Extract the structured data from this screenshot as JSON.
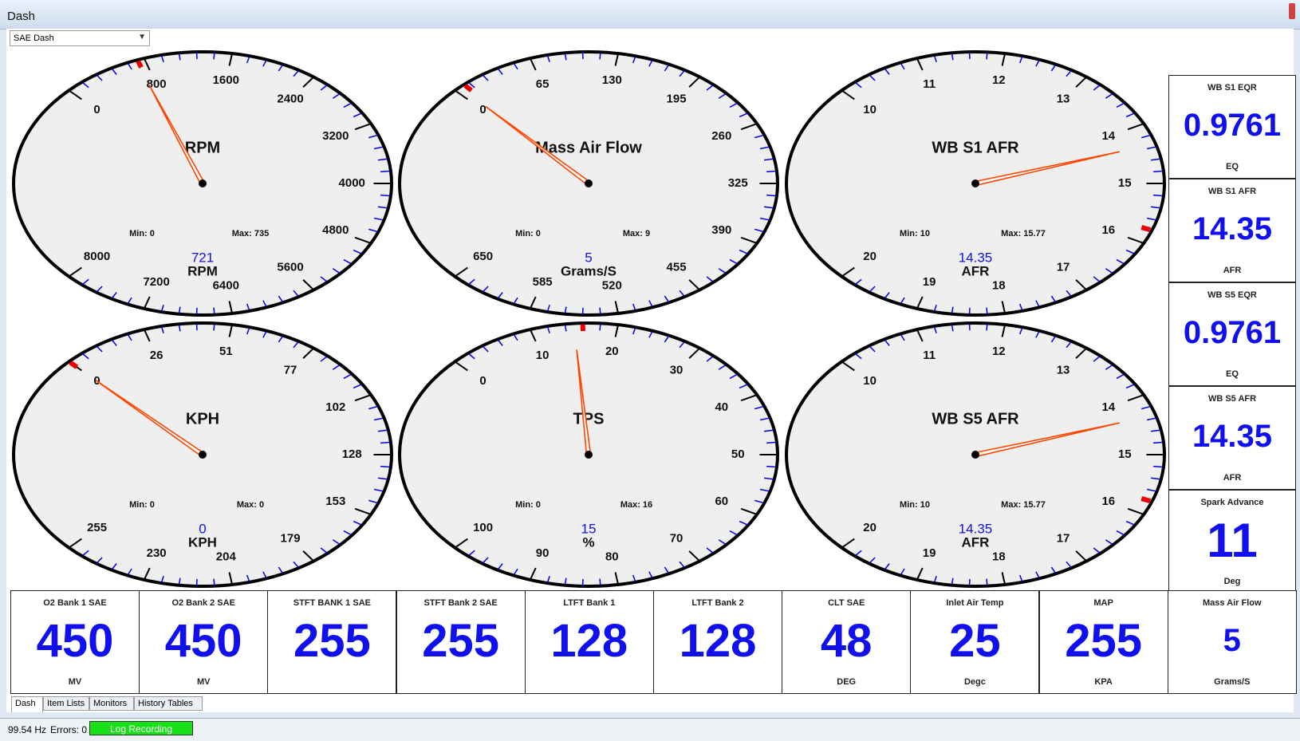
{
  "window": {
    "title": "Dash"
  },
  "selector": {
    "value": "SAE Dash"
  },
  "gauges": [
    {
      "title": "RPM",
      "unit": "RPM",
      "value": 721,
      "value_label": "721",
      "min_label": "Min: 0",
      "max_label": "Max: 735",
      "scale_min": 0,
      "scale_max": 8000,
      "ticks": [
        "0",
        "800",
        "1600",
        "2400",
        "3200",
        "4000",
        "4800",
        "5600",
        "6400",
        "7200",
        "8000"
      ]
    },
    {
      "title": "Mass Air Flow",
      "unit": "Grams/S",
      "value": 5,
      "value_label": "5",
      "min_label": "Min: 0",
      "max_label": "Max: 9",
      "scale_min": 0,
      "scale_max": 650,
      "ticks": [
        "0",
        "65",
        "130",
        "195",
        "260",
        "325",
        "390",
        "455",
        "520",
        "585",
        "650"
      ]
    },
    {
      "title": "WB S1 AFR",
      "unit": "AFR",
      "value": 14.35,
      "value_label": "14.35",
      "min_label": "Min: 10",
      "max_label": "Max: 15.77",
      "scale_min": 10,
      "scale_max": 20,
      "ticks": [
        "10",
        "11",
        "12",
        "13",
        "14",
        "15",
        "16",
        "17",
        "18",
        "19",
        "20"
      ]
    },
    {
      "title": "KPH",
      "unit": "KPH",
      "value": 0,
      "value_label": "0",
      "min_label": "Min: 0",
      "max_label": "Max: 0",
      "scale_min": 0,
      "scale_max": 255,
      "ticks": [
        "0",
        "26",
        "51",
        "77",
        "102",
        "128",
        "153",
        "179",
        "204",
        "230",
        "255"
      ]
    },
    {
      "title": "TPS",
      "unit": "%",
      "value": 15,
      "value_label": "15",
      "min_label": "Min: 0",
      "max_label": "Max: 16",
      "scale_min": 0,
      "scale_max": 100,
      "ticks": [
        "0",
        "10",
        "20",
        "30",
        "40",
        "50",
        "60",
        "70",
        "80",
        "90",
        "100"
      ]
    },
    {
      "title": "WB S5 AFR",
      "unit": "AFR",
      "value": 14.35,
      "value_label": "14.35",
      "min_label": "Min: 10",
      "max_label": "Max: 15.77",
      "scale_min": 10,
      "scale_max": 20,
      "ticks": [
        "10",
        "11",
        "12",
        "13",
        "14",
        "15",
        "16",
        "17",
        "18",
        "19",
        "20"
      ]
    }
  ],
  "side_panels": [
    {
      "label": "WB S1 EQR",
      "value": "0.9761",
      "unit": "EQ"
    },
    {
      "label": "WB S1 AFR",
      "value": "14.35",
      "unit": "AFR"
    },
    {
      "label": "WB S5 EQR",
      "value": "0.9761",
      "unit": "EQ"
    },
    {
      "label": "WB S5 AFR",
      "value": "14.35",
      "unit": "AFR"
    },
    {
      "label": "Spark Advance",
      "value": "11",
      "unit": "Deg"
    }
  ],
  "bottom_panels": [
    {
      "label": "O2 Bank 1 SAE",
      "value": "450",
      "unit": "MV"
    },
    {
      "label": "O2 Bank 2 SAE",
      "value": "450",
      "unit": "MV"
    },
    {
      "label": "STFT BANK 1 SAE",
      "value": "255",
      "unit": ""
    },
    {
      "label": "STFT Bank 2 SAE",
      "value": "255",
      "unit": ""
    },
    {
      "label": "LTFT Bank 1",
      "value": "128",
      "unit": ""
    },
    {
      "label": "LTFT Bank 2",
      "value": "128",
      "unit": ""
    },
    {
      "label": "CLT SAE",
      "value": "48",
      "unit": "DEG"
    },
    {
      "label": "Inlet Air Temp",
      "value": "25",
      "unit": "Degc"
    },
    {
      "label": "MAP",
      "value": "255",
      "unit": "KPA"
    },
    {
      "label": "Mass Air Flow",
      "value": "5",
      "unit": "Grams/S"
    }
  ],
  "tabs": [
    "Dash",
    "Item Lists",
    "Monitors",
    "History Tables"
  ],
  "status": {
    "rate": "99.54 Hz",
    "errors": "Errors: 0",
    "log_button": "Log Recording"
  },
  "colors": {
    "needle": "#ff4400",
    "value_blue": "#1010ee",
    "minor_tick": "#0000ee",
    "log_green": "#18e018"
  }
}
